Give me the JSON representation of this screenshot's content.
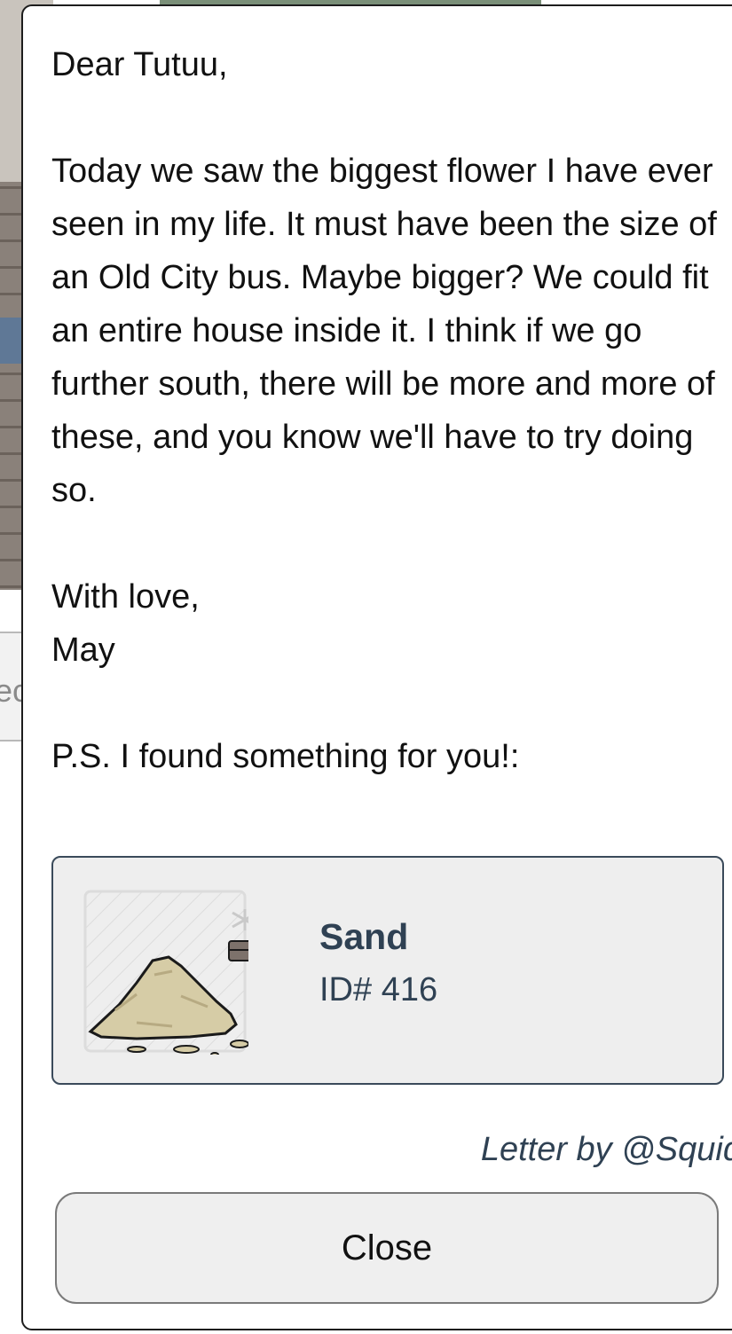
{
  "letter": {
    "body": "Dear Tutuu,\n\nToday we saw the biggest flower I have ever seen in my life. It must have been the size of an Old City bus. Maybe bigger? We could fit an entire house inside it. I think if we go further south, there will be more and more of these, and you know we'll have to try doing so.\n\nWith love,\nMay\n\nP.S. I found something for you!:",
    "author": "Letter by @Squid"
  },
  "item": {
    "name": "Sand",
    "id": "ID# 416",
    "icon": "sand-pile-icon"
  },
  "background": {
    "partial_button_text": "ec"
  },
  "actions": {
    "close_label": "Close"
  }
}
